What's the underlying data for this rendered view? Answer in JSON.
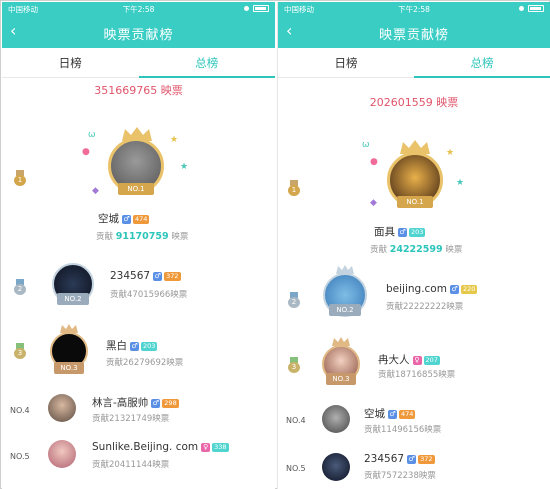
{
  "statusbar": {
    "carrier": "中国移动",
    "time": "下午2:58"
  },
  "nav": {
    "back_icon": "‹",
    "title": "映票贡献榜"
  },
  "tabs": [
    "日榜",
    "总榜"
  ],
  "left": {
    "total": "351669765 映票",
    "first": {
      "no_label": "NO.1",
      "name": "空城",
      "level": "474",
      "contrib_label": "贡献",
      "contrib_value": "91170759",
      "contrib_unit": "映票"
    },
    "second": {
      "no_label": "NO.2",
      "name": "234567",
      "level": "372",
      "contrib": "贡献47015966映票"
    },
    "third": {
      "no_label": "NO.3",
      "name": "黑白",
      "level": "203",
      "contrib": "贡献26279692映票"
    },
    "rows": [
      {
        "rank": "NO.4",
        "name": "林言-高服帅",
        "level": "298",
        "contrib": "贡献21321749映票"
      },
      {
        "rank": "NO.5",
        "name": "Sunlike.Beijing. com",
        "level": "338",
        "contrib": "贡献20411144映票"
      }
    ]
  },
  "right": {
    "total": "202601559 映票",
    "first": {
      "no_label": "NO.1",
      "name": "面具",
      "level": "203",
      "contrib_label": "贡献",
      "contrib_value": "24222599",
      "contrib_unit": "映票"
    },
    "second": {
      "no_label": "NO.2",
      "name": "beijing.com",
      "level": "220",
      "contrib": "贡献22222222映票"
    },
    "third": {
      "no_label": "NO.3",
      "name": "冉大人",
      "level": "207",
      "contrib": "贡献18716855映票"
    },
    "rows": [
      {
        "rank": "NO.4",
        "name": "空城",
        "level": "474",
        "contrib": "贡献11496156映票"
      },
      {
        "rank": "NO.5",
        "name": "234567",
        "level": "372",
        "contrib": "贡献7572238映票"
      }
    ]
  },
  "medals": [
    "1",
    "2",
    "3"
  ],
  "colors": {
    "accent": "#39cdc4",
    "total": "#e0546a",
    "gold": "#e9c26a"
  }
}
